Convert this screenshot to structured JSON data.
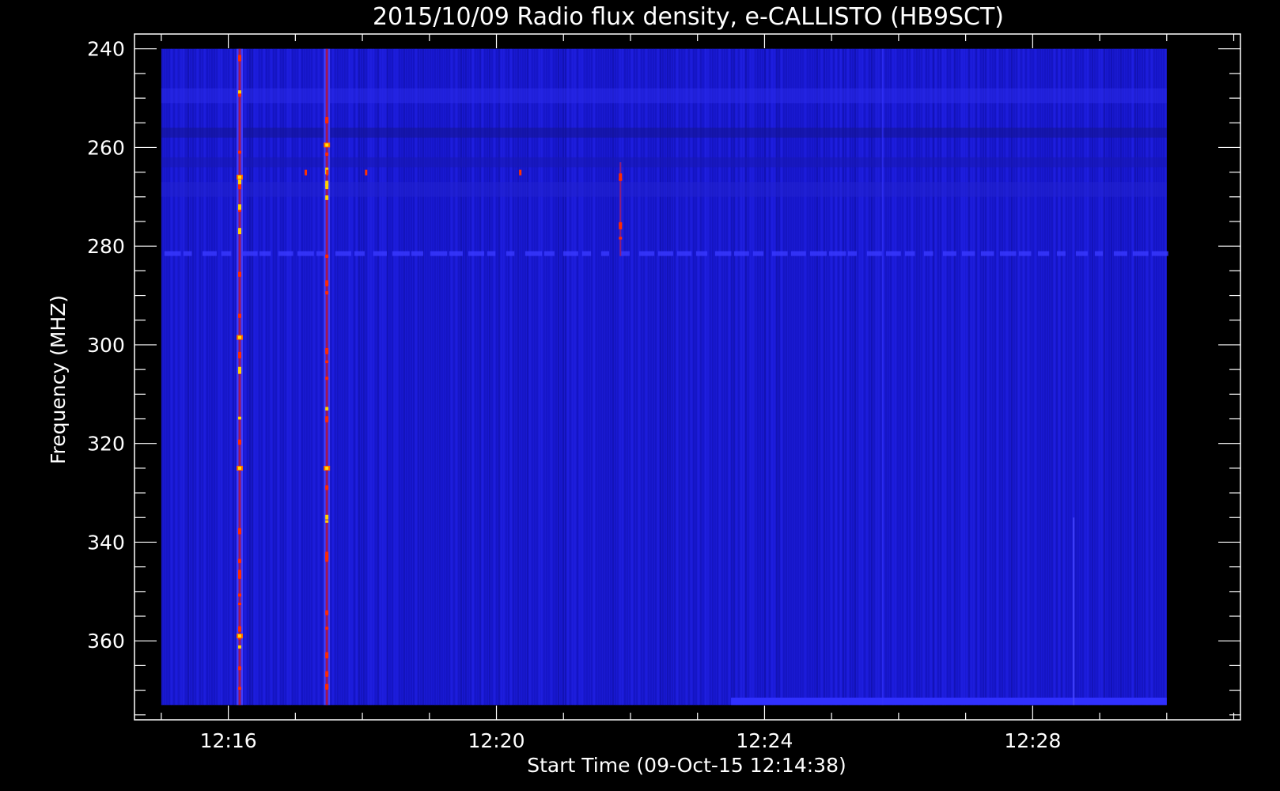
{
  "chart_data": {
    "type": "heatmap",
    "title": "2015/10/09  Radio flux density, e-CALLISTO (HB9SCT)",
    "xlabel": "Start Time (09-Oct-15 12:14:38)",
    "ylabel": "Frequency (MHZ)",
    "x_ticks": [
      "12:16",
      "12:20",
      "12:24",
      "12:28"
    ],
    "x_tick_minutes": [
      16,
      20,
      24,
      28
    ],
    "y_ticks": [
      "240",
      "260",
      "280",
      "300",
      "320",
      "340",
      "360"
    ],
    "y_tick_values": [
      240,
      260,
      280,
      300,
      320,
      340,
      360
    ],
    "y_axis_reversed": true,
    "x_range_minutes": [
      14.6,
      31.1
    ],
    "y_range_mhz": [
      237,
      376
    ],
    "data_x_range_minutes": [
      15.0,
      30.0
    ],
    "data_y_range_mhz": [
      240,
      373
    ],
    "colormap": [
      "#000000",
      "#0000ff",
      "#ff0000",
      "#ffff00"
    ],
    "background_level": "#1a1ad4",
    "bursts": [
      {
        "time_minutes": 16.17,
        "freq_mhz_range": [
          240,
          373
        ],
        "intensity": "high"
      },
      {
        "time_minutes": 17.47,
        "freq_mhz_range": [
          240,
          373
        ],
        "intensity": "high"
      },
      {
        "time_minutes": 21.85,
        "freq_mhz_range": [
          263,
          282
        ],
        "intensity": "medium"
      }
    ],
    "interference_band_mhz": 281.5,
    "grid": false,
    "legend": "none"
  }
}
